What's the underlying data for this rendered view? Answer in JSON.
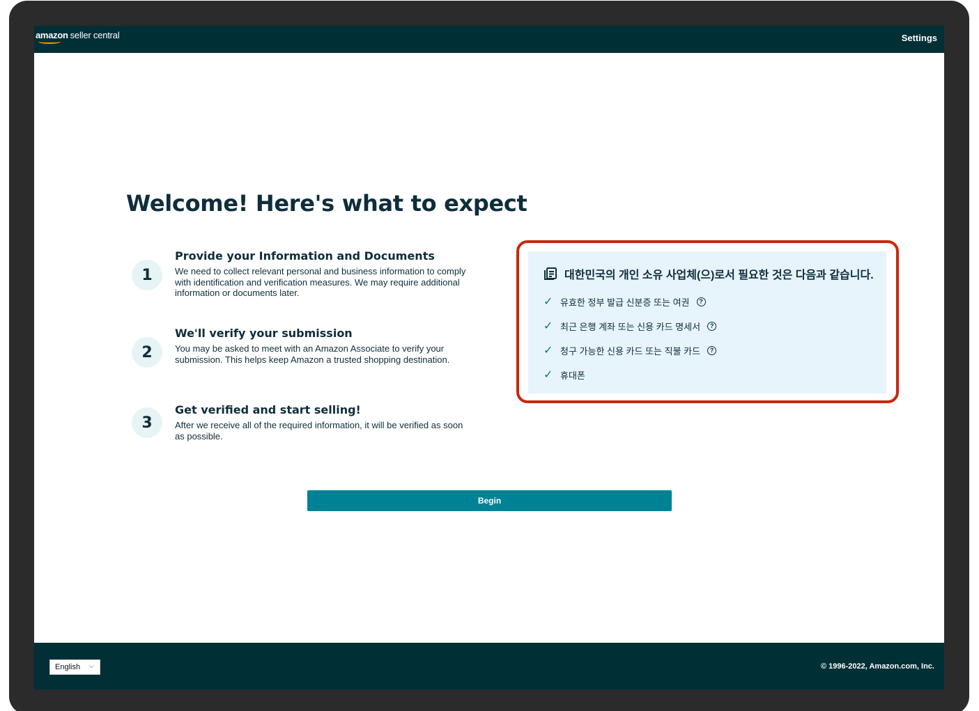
{
  "header": {
    "logo_brand": "amazon",
    "logo_product": "seller central",
    "settings_label": "Settings"
  },
  "main": {
    "title": "Welcome! Here's what to expect",
    "steps": [
      {
        "number": "1",
        "title": "Provide your Information and Documents",
        "description": "We need to collect relevant personal and business information to comply with identification and verification measures. We may require additional information or documents later."
      },
      {
        "number": "2",
        "title": "We'll verify your submission",
        "description": "You may be asked to meet with an Amazon Associate to verify your submission. This helps keep Amazon a trusted shopping destination."
      },
      {
        "number": "3",
        "title": "Get verified and start selling!",
        "description": "After we receive all of the required information, it will be verified as soon as possible."
      }
    ],
    "requirements": {
      "heading": "대한민국의 개인 소유 사업체(으)로서 필요한 것은 다음과 같습니다.",
      "items": [
        {
          "label": "유효한 정부 발급 신분증 또는 여권",
          "has_help": true
        },
        {
          "label": "최근 은행 계좌 또는 신용 카드 명세서",
          "has_help": true
        },
        {
          "label": "청구 가능한 신용 카드 또는 직불 카드",
          "has_help": true
        },
        {
          "label": "휴대폰",
          "has_help": false
        }
      ],
      "help_glyph": "?",
      "check_glyph": "✓"
    },
    "begin_label": "Begin"
  },
  "footer": {
    "language": "English",
    "copyright": "© 1996-2022, Amazon.com, Inc."
  },
  "colors": {
    "topbar": "#002f36",
    "button": "#008296",
    "panel": "#e7f4fb",
    "highlight": "#c8280c",
    "logo_smile": "#ff9900"
  }
}
